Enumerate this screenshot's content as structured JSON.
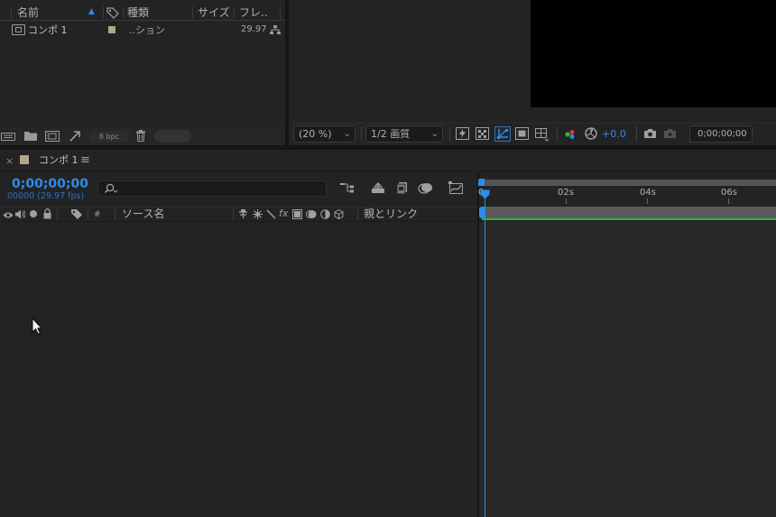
{
  "project": {
    "columns": {
      "name": "名前",
      "type": "種類",
      "size": "サイズ",
      "frame": "フレ.."
    },
    "item": {
      "name": "コンポ 1",
      "type": "..ション",
      "fps": "29.97"
    },
    "bpc": "8 bpc"
  },
  "viewer": {
    "zoom": "(20 %)",
    "resolution": "1/2 画質",
    "exposure": "+0.0",
    "timecode": "0;00;00;00"
  },
  "timeline": {
    "tab_close": "×",
    "tab_label": "コンポ 1",
    "tab_menu": "≡",
    "current_time": "0;00;00;00",
    "frame_info": "00000 (29.97 fps)",
    "columns": {
      "number": "#",
      "source_name": "ソース名",
      "fx": "fx",
      "parent": "親とリンク"
    },
    "ruler_labels": [
      "0s",
      "02s",
      "04s",
      "06s"
    ]
  },
  "colors": {
    "accent_blue": "#2d8ceb",
    "green_bar": "#2fb13a",
    "label_swatch": "#b4a58a"
  }
}
